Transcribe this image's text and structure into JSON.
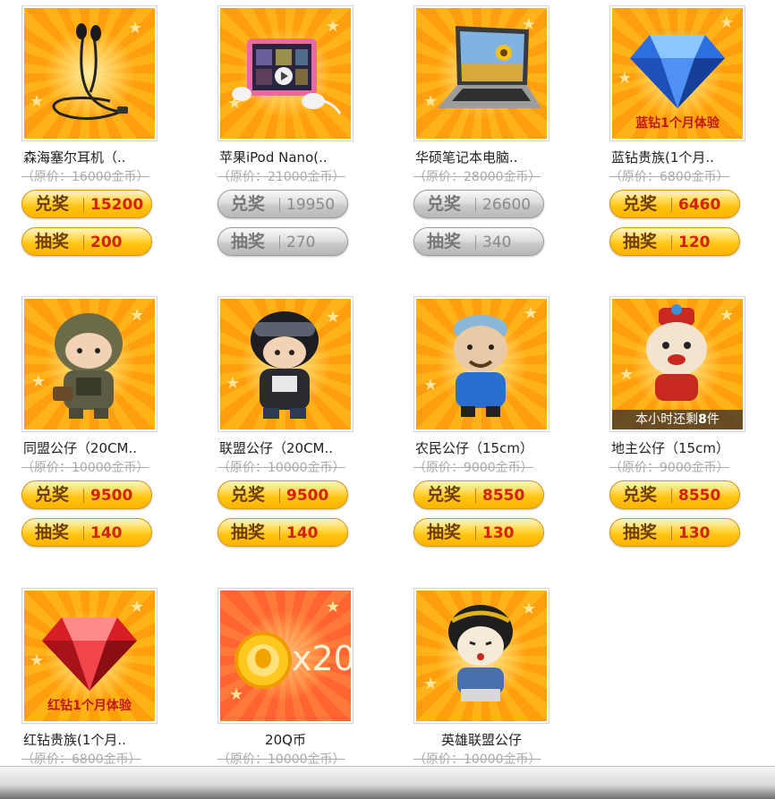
{
  "items": [
    {
      "title": "森海塞尔耳机（..",
      "orig_price": "（原价：16000金币）",
      "exchange_label": "兑奖",
      "exchange_price": "15200",
      "lottery_label": "抽奖",
      "lottery_price": "200",
      "enabled": true,
      "image": "earphones"
    },
    {
      "title": "苹果iPod Nano(..",
      "orig_price": "（原价：21000金币）",
      "exchange_label": "兑奖",
      "exchange_price": "19950",
      "lottery_label": "抽奖",
      "lottery_price": "270",
      "enabled": false,
      "image": "ipod-nano"
    },
    {
      "title": "华硕笔记本电脑..",
      "orig_price": "（原价：28000金币）",
      "exchange_label": "兑奖",
      "exchange_price": "26600",
      "lottery_label": "抽奖",
      "lottery_price": "340",
      "enabled": false,
      "image": "laptop"
    },
    {
      "title": "蓝钻贵族(1个月..",
      "orig_price": "（原价：6800金币）",
      "exchange_label": "兑奖",
      "exchange_price": "6460",
      "lottery_label": "抽奖",
      "lottery_price": "120",
      "enabled": true,
      "image": "blue-diamond",
      "image_text": "蓝钻1个月体验"
    },
    {
      "title": "同盟公仔（20CM..",
      "orig_price": "（原价：10000金币）",
      "exchange_label": "兑奖",
      "exchange_price": "9500",
      "lottery_label": "抽奖",
      "lottery_price": "140",
      "enabled": true,
      "image": "soldier-doll"
    },
    {
      "title": "联盟公仔（20CM..",
      "orig_price": "（原价：10000金币）",
      "exchange_label": "兑奖",
      "exchange_price": "9500",
      "lottery_label": "抽奖",
      "lottery_price": "140",
      "enabled": true,
      "image": "goggle-doll"
    },
    {
      "title": "农民公仔（15cm）",
      "orig_price": "（原价：9000金币）",
      "exchange_label": "兑奖",
      "exchange_price": "8550",
      "lottery_label": "抽奖",
      "lottery_price": "130",
      "enabled": true,
      "image": "farmer-doll"
    },
    {
      "title": "地主公仔（15cm）",
      "orig_price": "（原价：9000金币）",
      "exchange_label": "兑奖",
      "exchange_price": "8550",
      "lottery_label": "抽奖",
      "lottery_price": "130",
      "enabled": true,
      "image": "landlord-doll",
      "overlay_prefix": "本小时还剩",
      "overlay_count": "8",
      "overlay_suffix": "件"
    },
    {
      "title": "红钻贵族(1个月..",
      "orig_price": "（原价：6800金币）",
      "image": "red-diamond",
      "image_text": "红钻1个月体验"
    },
    {
      "title": "20Q币",
      "orig_price": "（原价：10000金币）",
      "image": "q-coin",
      "image_text": "x20"
    },
    {
      "title": "英雄联盟公仔",
      "orig_price": "（原价：10000金币）",
      "image": "hero-doll"
    }
  ],
  "colors": {
    "accent_red": "#d2220a",
    "button_gold": "#ffc412",
    "button_disabled": "#c8c8c8",
    "tile_orange": "#ffa614"
  }
}
